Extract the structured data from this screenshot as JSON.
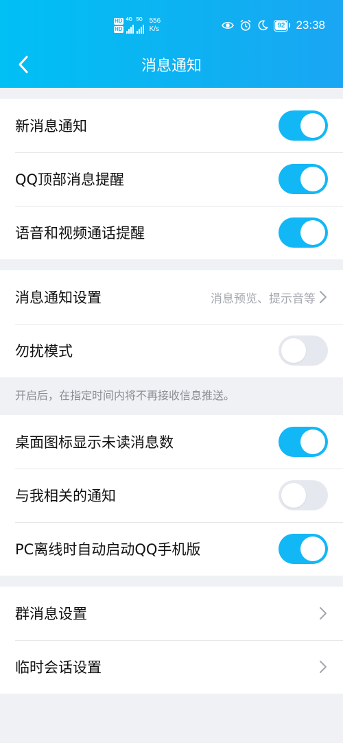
{
  "status_bar": {
    "hd1": "HD",
    "hd2": "HD",
    "net1": "4G",
    "net2": "5G",
    "speed_value": "556",
    "speed_unit": "K/s",
    "battery": "92",
    "time": "23:38",
    "icons": [
      "eye-icon",
      "alarm-icon",
      "moon-icon"
    ]
  },
  "nav": {
    "back_icon": "chevron-left-icon",
    "title": "消息通知"
  },
  "group1": [
    {
      "label": "新消息通知",
      "toggle": true
    },
    {
      "label": "QQ顶部消息提醒",
      "toggle": true
    },
    {
      "label": "语音和视频通话提醒",
      "toggle": true
    }
  ],
  "group2": {
    "notification_settings": {
      "label": "消息通知设置",
      "detail": "消息预览、提示音等"
    },
    "dnd": {
      "label": "勿扰模式",
      "toggle": false
    }
  },
  "dnd_note": "开启后，在指定时间内将不再接收信息推送。",
  "group3": [
    {
      "label": "桌面图标显示未读消息数",
      "toggle": true
    },
    {
      "label": "与我相关的通知",
      "toggle": false
    },
    {
      "label": "PC离线时自动启动QQ手机版",
      "toggle": true
    }
  ],
  "group4": [
    {
      "label": "群消息设置"
    },
    {
      "label": "临时会话设置"
    }
  ],
  "colors": {
    "accent": "#12b7f5",
    "toggle_off": "#e6e8ef",
    "background": "#f0f1f5"
  }
}
